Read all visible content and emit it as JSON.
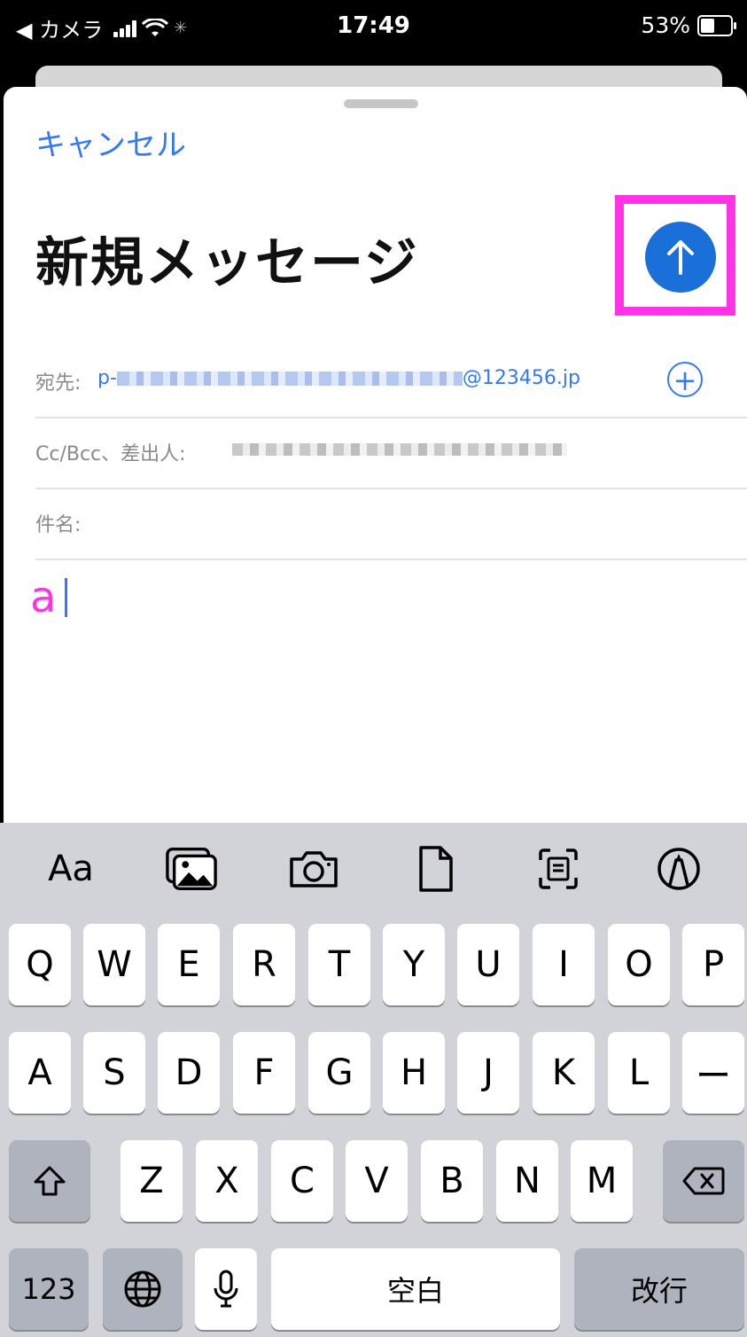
{
  "status_bar": {
    "back_app": "◀ カメラ",
    "time": "17:49",
    "battery": "53%",
    "battery_level": 0.53
  },
  "compose": {
    "cancel_label": "キャンセル",
    "title": "新規メッセージ",
    "to_label": "宛先:",
    "to_value_prefix": "p-",
    "to_value_suffix": "@123456.jp",
    "cc_label": "Cc/Bcc、差出人:",
    "subject_label": "件名:",
    "body_text": "a",
    "add_recipient_icon": "+"
  },
  "keyboard": {
    "toolbar": {
      "font_label": "Aa",
      "icons": [
        "photo-library-icon",
        "camera-icon",
        "document-icon",
        "scan-text-icon",
        "markup-icon"
      ]
    },
    "row1": [
      "Q",
      "W",
      "E",
      "R",
      "T",
      "Y",
      "U",
      "I",
      "O",
      "P"
    ],
    "row2": [
      "A",
      "S",
      "D",
      "F",
      "G",
      "H",
      "J",
      "K",
      "L",
      "ー"
    ],
    "row3": [
      "Z",
      "X",
      "C",
      "V",
      "B",
      "N",
      "M"
    ],
    "numbers_label": "123",
    "space_label": "空白",
    "return_label": "改行"
  },
  "colors": {
    "accent": "#3478f6",
    "send_button": "#1a6fd8",
    "highlight": "#ff33e5"
  }
}
